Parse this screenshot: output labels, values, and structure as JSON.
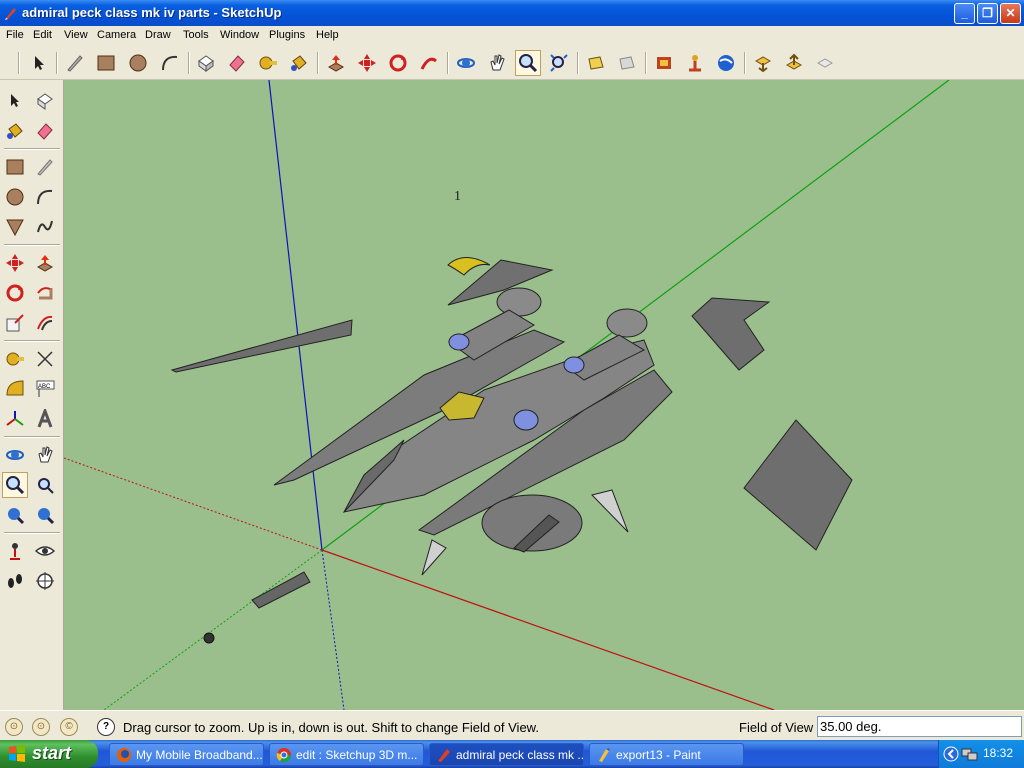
{
  "window": {
    "title": "admiral peck class mk iv parts - SketchUp",
    "minimize": "_",
    "maximize": "❐",
    "close": "✕"
  },
  "menu": [
    "File",
    "Edit",
    "View",
    "Camera",
    "Draw",
    "Tools",
    "Window",
    "Plugins",
    "Help"
  ],
  "viewport": {
    "background": "#9abf8c",
    "label": "1"
  },
  "status": {
    "hint": "Drag cursor to zoom.  Up is in, down is out. Shift to change Field of View.",
    "help_icon": "?",
    "fov_label": "Field of View",
    "fov_value": "35.00 deg."
  },
  "taskbar": {
    "start": "start",
    "items": [
      {
        "label": "My Mobile Broadband..."
      },
      {
        "label": "edit : Sketchup 3D m..."
      },
      {
        "label": "admiral peck class mk ..."
      },
      {
        "label": "export13 - Paint"
      }
    ],
    "clock": "18:32"
  },
  "colors": {
    "axis_red": "#c01010",
    "axis_green": "#10a010",
    "axis_blue": "#1010c0",
    "model_gray": "#7a7a7a"
  }
}
